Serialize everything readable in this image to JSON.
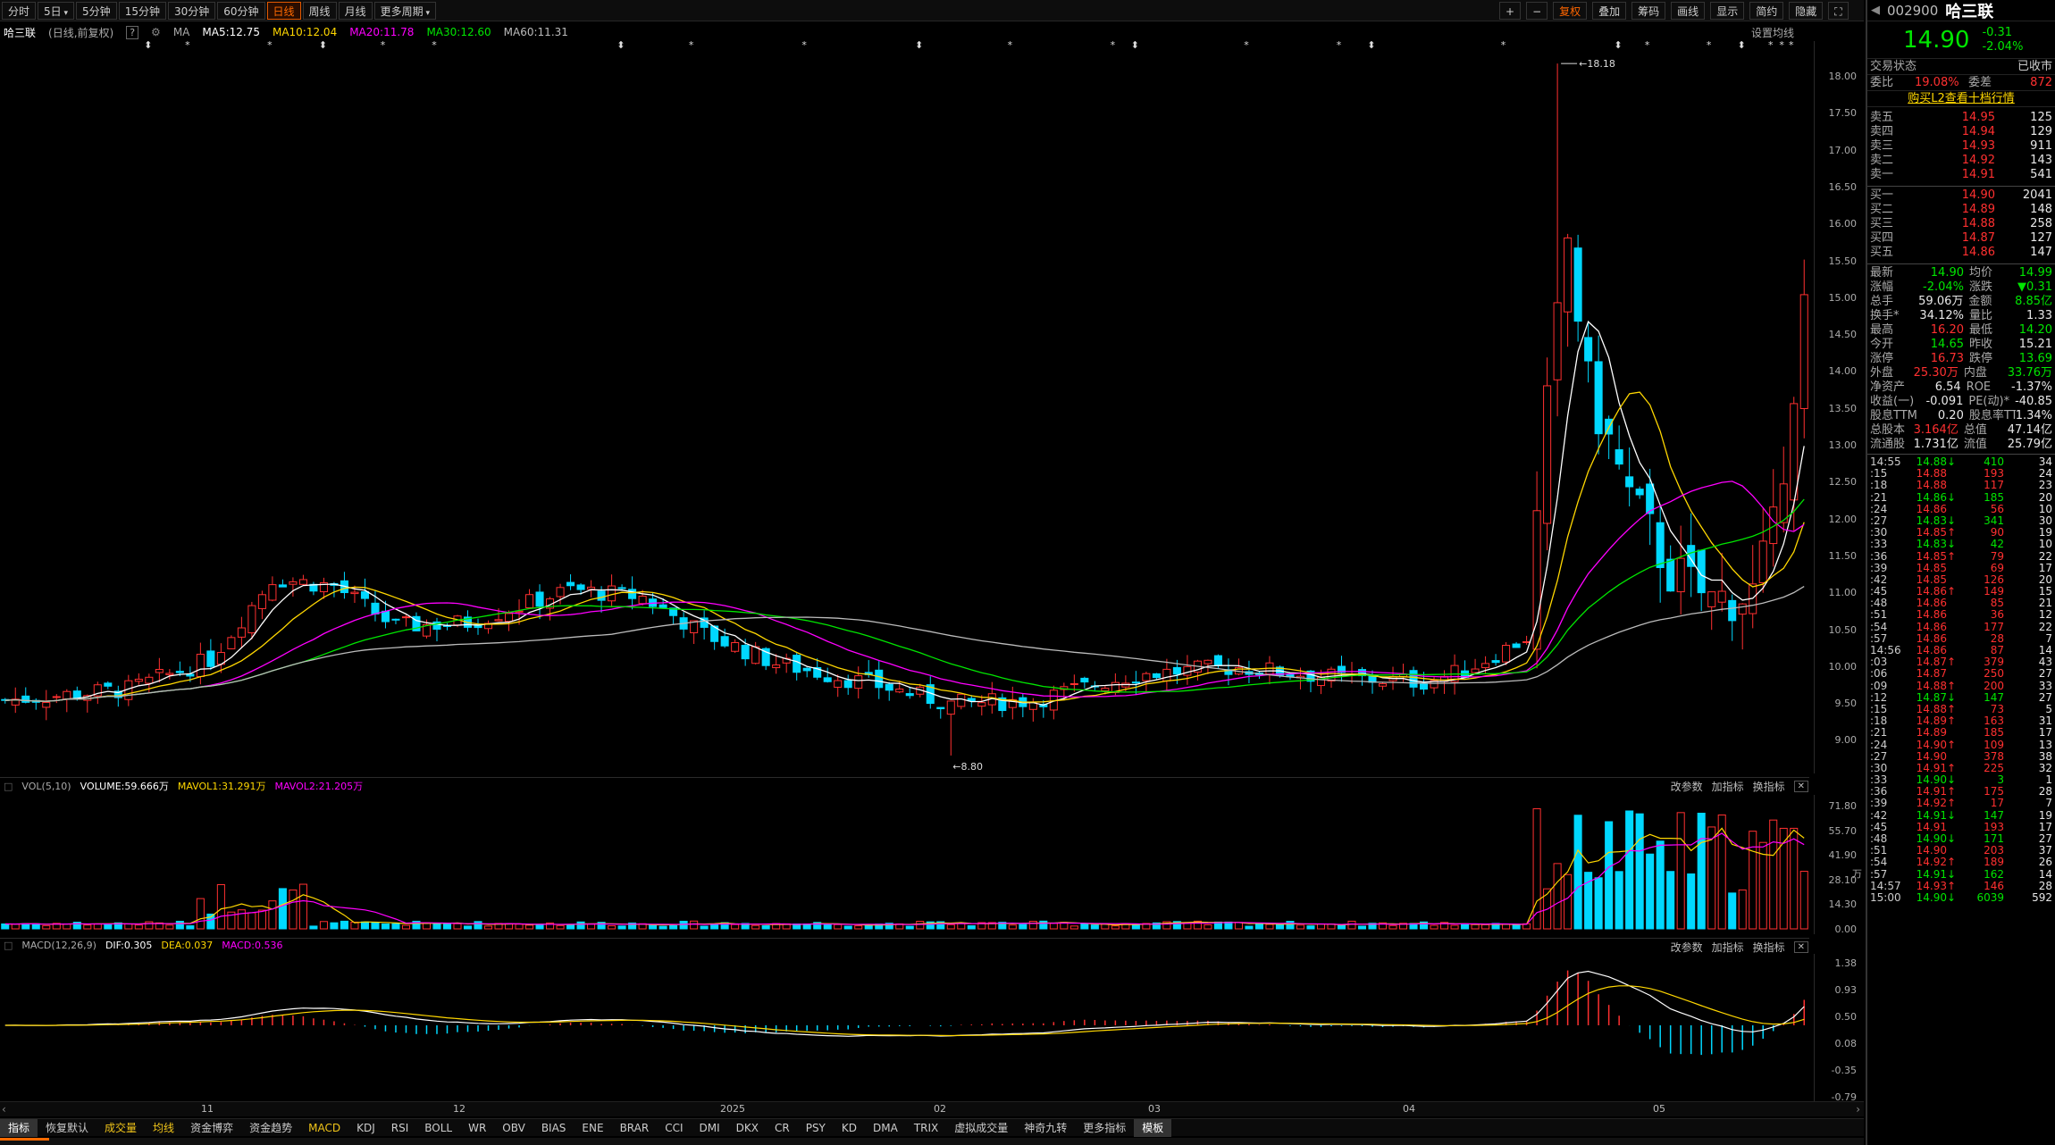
{
  "toolbar": {
    "periods": [
      "分时",
      "5日",
      "5分钟",
      "15分钟",
      "30分钟",
      "60分钟",
      "日线",
      "周线",
      "月线",
      "更多周期"
    ],
    "active_period": "日线",
    "right_buttons": [
      "+",
      "−",
      "复权",
      "叠加",
      "筹码",
      "画线",
      "显示",
      "简约",
      "隐藏"
    ]
  },
  "header": {
    "name": "哈三联",
    "adjust": "(日线,前复权)",
    "ma": [
      {
        "label": "MA5:12.75",
        "color": "#ffffff"
      },
      {
        "label": "MA10:12.04",
        "color": "#ffd700"
      },
      {
        "label": "MA20:11.78",
        "color": "#ff00ff"
      },
      {
        "label": "MA30:12.60",
        "color": "#00e600"
      },
      {
        "label": "MA60:11.31",
        "color": "#bbbbbb"
      }
    ],
    "setting": "设置均线"
  },
  "main_axis": [
    "18.00",
    "17.50",
    "17.00",
    "16.50",
    "16.00",
    "15.50",
    "15.00",
    "14.50",
    "14.00",
    "13.50",
    "13.00",
    "12.50",
    "12.00",
    "11.50",
    "11.00",
    "10.50",
    "10.00",
    "9.50",
    "9.00"
  ],
  "annotations": {
    "high": "18.18",
    "low": "8.80"
  },
  "x_axis": [
    {
      "label": "11",
      "pos": 225
    },
    {
      "label": "12",
      "pos": 507
    },
    {
      "label": "2025",
      "pos": 806
    },
    {
      "label": "02",
      "pos": 1045
    },
    {
      "label": "03",
      "pos": 1285
    },
    {
      "label": "04",
      "pos": 1570
    },
    {
      "label": "05",
      "pos": 1850
    }
  ],
  "vol": {
    "title": "VOL(5,10)",
    "volume": "VOLUME:59.666万",
    "mavol1": "MAVOL1:31.291万",
    "mavol2": "MAVOL2:21.205万",
    "ticks": [
      "71.80",
      "55.70",
      "41.90",
      "28.10",
      "14.30",
      "0.00"
    ],
    "unit": "万"
  },
  "macd": {
    "title": "MACD(12,26,9)",
    "dif": "DIF:0.305",
    "dea": "DEA:0.037",
    "macd": "MACD:0.536",
    "ticks": [
      "1.38",
      "0.93",
      "0.50",
      "0.08",
      "-0.35",
      "-0.79"
    ]
  },
  "panel_tools": [
    "改参数",
    "加指标",
    "换指标"
  ],
  "bottom_tabs": [
    "指标",
    "恢复默认",
    "成交量",
    "均线",
    "资金博弈",
    "资金趋势",
    "MACD",
    "KDJ",
    "RSI",
    "BOLL",
    "WR",
    "OBV",
    "BIAS",
    "ENE",
    "BRAR",
    "CCI",
    "DMI",
    "DKX",
    "CR",
    "PSY",
    "KD",
    "DMA",
    "TRIX",
    "虚拟成交量",
    "神奇九转",
    "更多指标",
    "模板"
  ],
  "quote": {
    "code": "002900",
    "name": "哈三联",
    "price": "14.90",
    "change": "-0.31",
    "pct": "-2.04%",
    "status_label": "交易状态",
    "status": "已收市",
    "weibi_label": "委比",
    "weibi": "19.08%",
    "weicha_label": "委差",
    "weicha": "872",
    "l2": "购买L2查看十档行情",
    "asks": [
      {
        "label": "卖五",
        "price": "14.95",
        "vol": "125"
      },
      {
        "label": "卖四",
        "price": "14.94",
        "vol": "129"
      },
      {
        "label": "卖三",
        "price": "14.93",
        "vol": "911"
      },
      {
        "label": "卖二",
        "price": "14.92",
        "vol": "143"
      },
      {
        "label": "卖一",
        "price": "14.91",
        "vol": "541"
      }
    ],
    "bids": [
      {
        "label": "买一",
        "price": "14.90",
        "vol": "2041"
      },
      {
        "label": "买二",
        "price": "14.89",
        "vol": "148"
      },
      {
        "label": "买三",
        "price": "14.88",
        "vol": "258"
      },
      {
        "label": "买四",
        "price": "14.87",
        "vol": "127"
      },
      {
        "label": "买五",
        "price": "14.86",
        "vol": "147"
      }
    ],
    "stats": [
      [
        "最新",
        "14.90",
        "均价",
        "14.99"
      ],
      [
        "涨幅",
        "-2.04%",
        "涨跌",
        "▼0.31"
      ],
      [
        "总手",
        "59.06万",
        "金额",
        "8.85亿"
      ],
      [
        "换手*",
        "34.12%",
        "量比",
        "1.33"
      ],
      [
        "最高",
        "16.20",
        "最低",
        "14.20"
      ],
      [
        "今开",
        "14.65",
        "昨收",
        "15.21"
      ],
      [
        "涨停",
        "16.73",
        "跌停",
        "13.69"
      ],
      [
        "外盘",
        "25.30万",
        "内盘",
        "33.76万"
      ],
      [
        "净资产",
        "6.54",
        "ROE",
        "-1.37%"
      ],
      [
        "收益(一)",
        "-0.091",
        "PE(动)*",
        "-40.85"
      ],
      [
        "股息TTM",
        "0.20",
        "股息率TTM",
        "1.34%"
      ],
      [
        "总股本",
        "3.164亿",
        "总值",
        "47.14亿"
      ],
      [
        "流通股",
        "1.731亿",
        "流值",
        "25.79亿"
      ]
    ],
    "ticks": [
      [
        "14:55",
        "14.88",
        "↓",
        "410",
        "34"
      ],
      [
        ":15",
        "14.88",
        "",
        "193",
        "24"
      ],
      [
        ":18",
        "14.88",
        "",
        "117",
        "23"
      ],
      [
        ":21",
        "14.86",
        "↓",
        "185",
        "20"
      ],
      [
        ":24",
        "14.86",
        "",
        "56",
        "10"
      ],
      [
        ":27",
        "14.83",
        "↓",
        "341",
        "30"
      ],
      [
        ":30",
        "14.85",
        "↑",
        "90",
        "19"
      ],
      [
        ":33",
        "14.83",
        "↓",
        "42",
        "10"
      ],
      [
        ":36",
        "14.85",
        "↑",
        "79",
        "22"
      ],
      [
        ":39",
        "14.85",
        "",
        "69",
        "17"
      ],
      [
        ":42",
        "14.85",
        "",
        "126",
        "20"
      ],
      [
        ":45",
        "14.86",
        "↑",
        "149",
        "15"
      ],
      [
        ":48",
        "14.86",
        "",
        "85",
        "21"
      ],
      [
        ":51",
        "14.86",
        "",
        "36",
        "12"
      ],
      [
        ":54",
        "14.86",
        "",
        "177",
        "22"
      ],
      [
        ":57",
        "14.86",
        "",
        "28",
        "7"
      ],
      [
        "14:56",
        "14.86",
        "",
        "87",
        "14"
      ],
      [
        ":03",
        "14.87",
        "↑",
        "379",
        "43"
      ],
      [
        ":06",
        "14.87",
        "",
        "250",
        "27"
      ],
      [
        ":09",
        "14.88",
        "↑",
        "200",
        "33"
      ],
      [
        ":12",
        "14.87",
        "↓",
        "147",
        "27"
      ],
      [
        ":15",
        "14.88",
        "↑",
        "73",
        "5"
      ],
      [
        ":18",
        "14.89",
        "↑",
        "163",
        "31"
      ],
      [
        ":21",
        "14.89",
        "",
        "185",
        "17"
      ],
      [
        ":24",
        "14.90",
        "↑",
        "109",
        "13"
      ],
      [
        ":27",
        "14.90",
        "",
        "378",
        "38"
      ],
      [
        ":30",
        "14.91",
        "↑",
        "225",
        "32"
      ],
      [
        ":33",
        "14.90",
        "↓",
        "3",
        "1"
      ],
      [
        ":36",
        "14.91",
        "↑",
        "175",
        "28"
      ],
      [
        ":39",
        "14.92",
        "↑",
        "17",
        "7"
      ],
      [
        ":42",
        "14.91",
        "↓",
        "147",
        "19"
      ],
      [
        ":45",
        "14.91",
        "",
        "193",
        "17"
      ],
      [
        ":48",
        "14.90",
        "↓",
        "171",
        "27"
      ],
      [
        ":51",
        "14.90",
        "",
        "203",
        "37"
      ],
      [
        ":54",
        "14.92",
        "↑",
        "189",
        "26"
      ],
      [
        ":57",
        "14.91",
        "↓",
        "162",
        "14"
      ],
      [
        "14:57",
        "14.93",
        "↑",
        "146",
        "28"
      ],
      [
        "15:00",
        "14.90",
        "↓",
        "6039",
        "592"
      ]
    ]
  },
  "colors": {
    "up": "#ff3030",
    "down": "#00d8ff",
    "ma5": "#ffffff",
    "ma10": "#ffd700",
    "ma20": "#ff00ff",
    "ma30": "#00e600",
    "ma60": "#bbbbbb",
    "accent": "#ff6a00"
  }
}
